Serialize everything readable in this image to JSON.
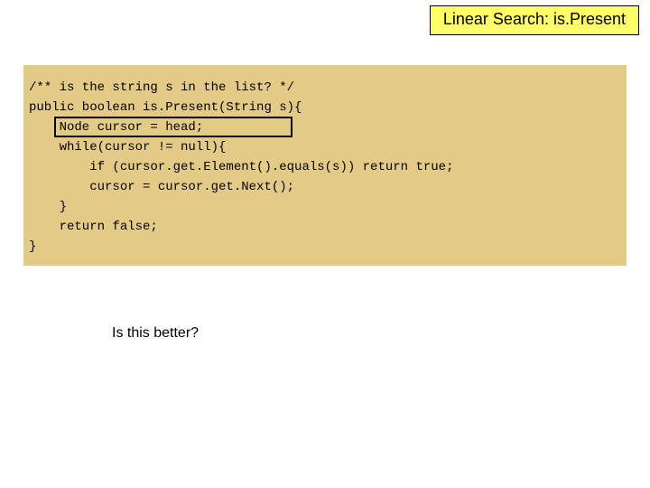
{
  "title": "Linear Search: is.Present",
  "code": {
    "l1": "/** is the string s in the list? */",
    "l2": "public boolean is.Present(String s){",
    "l3": "    Node cursor = head;",
    "l4": "    while(cursor != null){",
    "l5": "        if (cursor.get.Element().equals(s)) return true;",
    "l6": "        cursor = cursor.get.Next();",
    "l7": "    }",
    "l8": "    return false;",
    "l9": "}"
  },
  "caption": "Is this better?"
}
